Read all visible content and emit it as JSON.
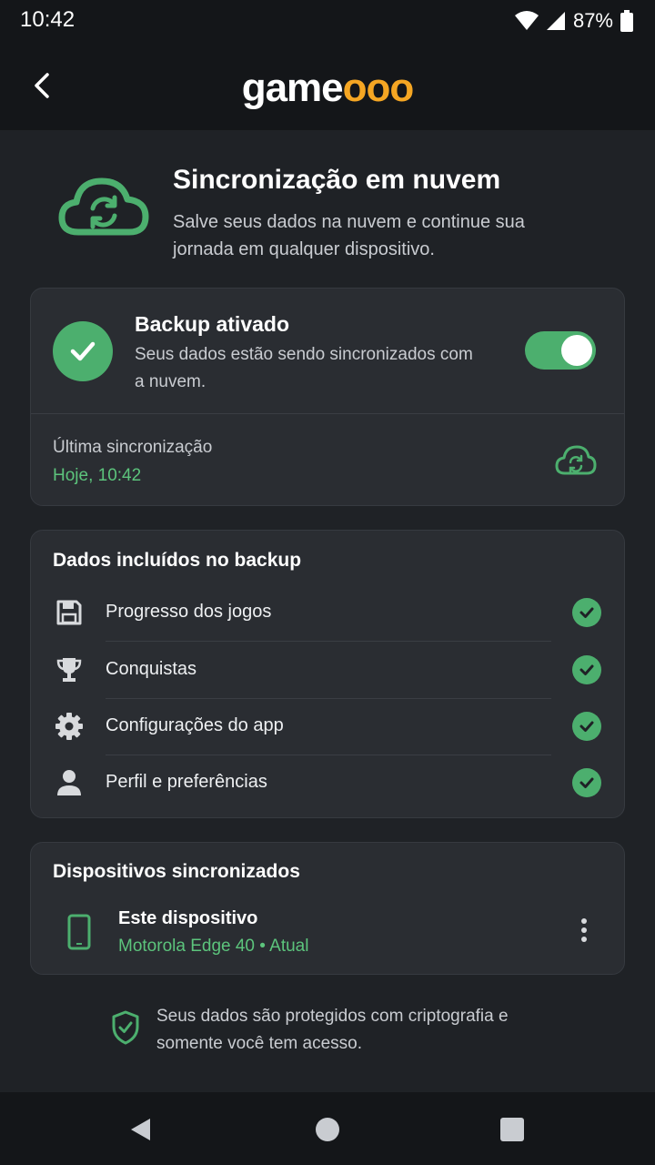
{
  "status_bar": {
    "time": "10:42",
    "battery": "87%"
  },
  "header": {
    "logo_main": "game",
    "logo_accent": "ooo"
  },
  "hero": {
    "title": "Sincronização em nuvem",
    "subtitle": "Salve seus dados na nuvem e continue sua jornada em qualquer dispositivo."
  },
  "backup": {
    "title": "Backup ativado",
    "description": "Seus dados estão sendo sincronizados com a nuvem.",
    "enabled": true,
    "last_sync_label": "Última sincronização",
    "last_sync_value": "Hoje, 10:42"
  },
  "included": {
    "heading": "Dados incluídos no backup",
    "items": [
      {
        "label": "Progresso dos jogos",
        "icon": "save-icon",
        "included": true
      },
      {
        "label": "Conquistas",
        "icon": "trophy-icon",
        "included": true
      },
      {
        "label": "Configurações do app",
        "icon": "gear-icon",
        "included": true
      },
      {
        "label": "Perfil e preferências",
        "icon": "person-icon",
        "included": true
      }
    ]
  },
  "devices": {
    "heading": "Dispositivos sincronizados",
    "items": [
      {
        "name": "Este dispositivo",
        "model": "Motorola Edge 40 • Atual"
      }
    ]
  },
  "footer": {
    "security_note": "Seus dados são protegidos com criptografia e somente você tem acesso."
  },
  "colors": {
    "accent_green": "#4caf6e",
    "brand_orange": "#f5a623",
    "background": "#1f2226",
    "card": "#2a2d32"
  }
}
